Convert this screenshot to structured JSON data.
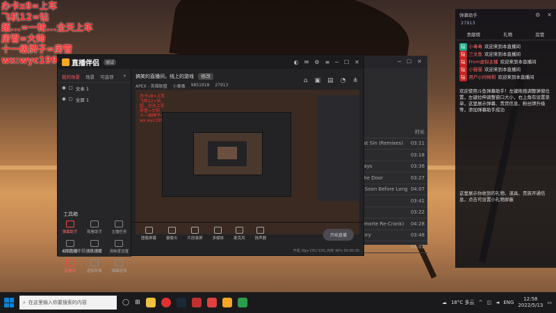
{
  "overlay_lines": [
    "办卡x8=上车",
    "飞机12=钻",
    "超...=一轮...全天上车",
    "房管=大帅",
    "十一级牌子=房管",
    "wx:wyc199906"
  ],
  "chat": {
    "title": "弹幕助手",
    "stat": "27913",
    "tabs": [
      "贡献榜",
      "礼物",
      "房管"
    ],
    "messages": [
      {
        "tag": "钻",
        "name": "小毒毒",
        "text": "欢迎来到本直播间"
      },
      {
        "tag": "钻",
        "name": "三文鱼",
        "text": "欢迎来到本直播间"
      },
      {
        "tag": "钻",
        "name": "From虚拟主播",
        "text": "欢迎来到本直播间"
      },
      {
        "tag": "钻",
        "name": "小猫猫",
        "text": "欢迎来到本直播间"
      },
      {
        "tag": "钻",
        "name": "用户小时候和",
        "text": "欢迎来到本直播间"
      }
    ],
    "note": "欢迎使用斗鱼弹幕助手！左键拖拽调整弹窗位置，左键拉伸调整窗口大小，右上角有设置菜单，这里展示弹幕、贵宾信息、粉丝牌升级等，添加弹幕助手成功",
    "note2": "这里展示你收到的礼物、道具、贵族开通信息，点击可设置小礼物屏蔽"
  },
  "backwin": {
    "col_header": "时长",
    "rows": [
      {
        "name": "ast Sin (Remixes)",
        "dur": "03:11"
      },
      {
        "name": "s",
        "dur": "03:18"
      },
      {
        "name": "days",
        "dur": "03:36"
      },
      {
        "name": "The Door",
        "dur": "03:27"
      },
      {
        "name": "s Soon Before Long",
        "dur": "04:07"
      },
      {
        "name": "",
        "dur": "03:41"
      },
      {
        "name": "",
        "dur": "03:22"
      },
      {
        "name": "amorte Re-Crank)",
        "dur": "04:28"
      },
      {
        "name": "sory",
        "dur": "03:48"
      },
      {
        "name": "",
        "dur": "04:01"
      }
    ]
  },
  "app": {
    "name": "直播伴侣",
    "version": "测试",
    "scene_tabs": [
      "我的场景",
      "场景",
      "可选项"
    ],
    "sources": [
      "文本 1",
      "全屏 1"
    ],
    "tools_header": "工具箱",
    "tools": [
      "弹幕助手",
      "观看助手",
      "主播任务",
      "视频直播",
      "多人连麦",
      "清晰度设置",
      "直播间",
      "虚拟形象",
      "弹幕增强",
      "更多",
      "设置",
      "下载"
    ],
    "footer_left": "4月直播伴侣优惠领取",
    "room_title": "搞笑的直播间，线上的游戏",
    "room_chip": "修改",
    "room_sub": [
      "APEX - 英雄联盟",
      "小毒毒",
      "9851918",
      "27913"
    ],
    "preview_lines": [
      "办卡x8=上车",
      "飞机12=钻",
      "超...全天上车",
      "房管=大帅",
      "十一级牌子=房管",
      "wx:wyc199906"
    ],
    "controls": [
      "图像屏幕",
      "摄像头",
      "片段录屏",
      "多媒体",
      "麦克风",
      "扬声器"
    ],
    "live_button": "开始直播",
    "status": "开机 0fps  CPU 33%  内存 36%  00:00:00"
  },
  "taskbar": {
    "search_placeholder": "在这里输入你要搜索的内容",
    "weather": "18°C 多云",
    "lang": "ENG",
    "time": "12:58",
    "date": "2022/5/13"
  }
}
